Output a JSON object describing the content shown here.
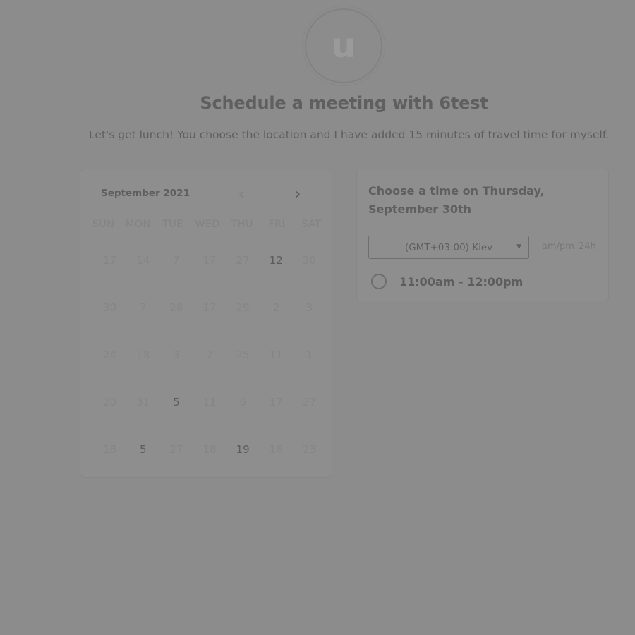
{
  "header": {
    "avatar_letter": "u",
    "title": "Schedule a meeting with 6test",
    "description": "Let's get lunch! You choose the location and I have added 15 minutes of travel time for myself."
  },
  "calendar": {
    "month_label": "September 2021",
    "prev_icon": "chevron-left-icon",
    "next_icon": "chevron-right-icon",
    "weekdays": [
      "SUN",
      "MON",
      "TUE",
      "WED",
      "THU",
      "FRI",
      "SAT"
    ],
    "weeks": [
      [
        {
          "d": "17"
        },
        {
          "d": "14"
        },
        {
          "d": "7"
        },
        {
          "d": "17"
        },
        {
          "d": "27"
        },
        {
          "d": "12",
          "active": true
        },
        {
          "d": "30"
        }
      ],
      [
        {
          "d": "30"
        },
        {
          "d": "7"
        },
        {
          "d": "28"
        },
        {
          "d": "17"
        },
        {
          "d": "29"
        },
        {
          "d": "2"
        },
        {
          "d": "3"
        }
      ],
      [
        {
          "d": "24"
        },
        {
          "d": "18"
        },
        {
          "d": "3"
        },
        {
          "d": "7"
        },
        {
          "d": "25"
        },
        {
          "d": "11"
        },
        {
          "d": "1"
        }
      ],
      [
        {
          "d": "20"
        },
        {
          "d": "31"
        },
        {
          "d": "5",
          "active": true
        },
        {
          "d": "11"
        },
        {
          "d": "6"
        },
        {
          "d": "17"
        },
        {
          "d": "27"
        }
      ],
      [
        {
          "d": "18"
        },
        {
          "d": "5",
          "active": true
        },
        {
          "d": "27"
        },
        {
          "d": "18"
        },
        {
          "d": "19",
          "active": true
        },
        {
          "d": "16"
        },
        {
          "d": "23"
        }
      ]
    ]
  },
  "time_panel": {
    "heading": "Choose a time on Thursday, September 30th",
    "timezone": "(GMT+03:00) Kiev",
    "format_ampm": "am/pm",
    "format_24h": "24h",
    "slots": [
      "11:00am - 12:00pm"
    ]
  }
}
